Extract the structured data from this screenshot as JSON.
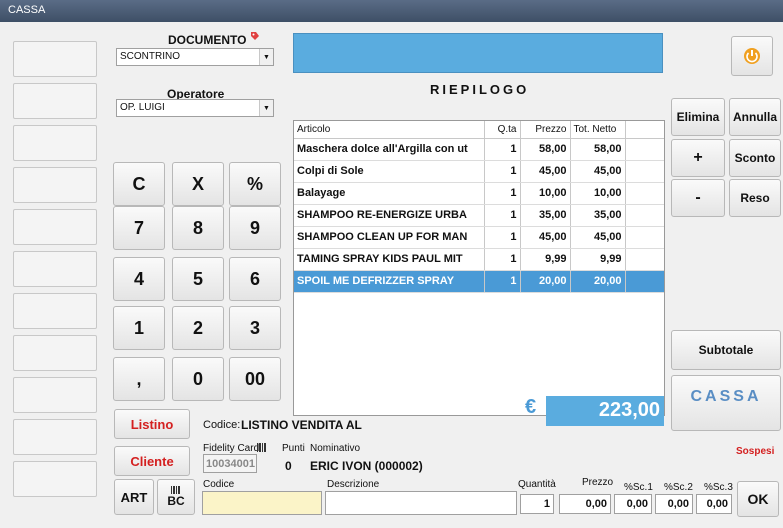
{
  "window": {
    "title": "CASSA"
  },
  "documento": {
    "label": "DOCUMENTO",
    "value": "SCONTRINO"
  },
  "operatore": {
    "label": "Operatore",
    "value": "OP. LUIGI"
  },
  "riepilogo": {
    "title": "RIEPILOGO",
    "columns": [
      "Articolo",
      "Q.ta",
      "Prezzo",
      "Tot. Netto"
    ],
    "rows": [
      [
        "Maschera dolce all'Argilla con ut",
        "1",
        "58,00",
        "58,00"
      ],
      [
        "Colpi di Sole",
        "1",
        "45,00",
        "45,00"
      ],
      [
        "Balayage",
        "1",
        "10,00",
        "10,00"
      ],
      [
        "SHAMPOO RE-ENERGIZE URBA",
        "1",
        "35,00",
        "35,00"
      ],
      [
        "SHAMPOO CLEAN UP FOR MAN",
        "1",
        "45,00",
        "45,00"
      ],
      [
        "TAMING SPRAY KIDS PAUL MIT",
        "1",
        "9,99",
        "9,99"
      ],
      [
        "SPOIL ME DEFRIZZER SPRAY",
        "1",
        "20,00",
        "20,00"
      ]
    ],
    "selected_row": 6
  },
  "keypad": {
    "c": "C",
    "x": "X",
    "pct": "%",
    "k7": "7",
    "k8": "8",
    "k9": "9",
    "k4": "4",
    "k5": "5",
    "k6": "6",
    "k1": "1",
    "k2": "2",
    "k3": "3",
    "comma": ",",
    "k0": "0",
    "k00": "00"
  },
  "actions": {
    "elimina": "Elimina",
    "annulla": "Annulla",
    "plus": "+",
    "sconto": "Sconto",
    "minus": "-",
    "reso": "Reso",
    "subtotale": "Subtotale",
    "cassa": "CASSA",
    "ok": "OK"
  },
  "total": {
    "currency": "€",
    "value": "223,00"
  },
  "listino": {
    "button": "Listino",
    "codice_label": "Codice:",
    "codice_value": "LISTINO VENDITA AL"
  },
  "cliente": {
    "button": "Cliente",
    "fidelity_label": "Fidelity Card",
    "fidelity_value": "10034001",
    "punti_label": "Punti",
    "punti_value": "0",
    "nominativo_label": "Nominativo",
    "nominativo_value": "ERIC IVON (000002)",
    "sospesi": "Sospesi"
  },
  "entry": {
    "art": "ART",
    "bc": "BC",
    "codice_label": "Codice",
    "codice_value": "",
    "descrizione_label": "Descrizione",
    "descrizione_value": "",
    "quantita_label": "Quantità",
    "quantita_value": "1",
    "prezzo_label": "Prezzo",
    "prezzo_value": "0,00",
    "sc1_label": "%Sc.1",
    "sc1_value": "0,00",
    "sc2_label": "%Sc.2",
    "sc2_value": "0,00",
    "sc3_label": "%Sc.3",
    "sc3_value": "0,00"
  },
  "colors": {
    "accent": "#4a9ad6",
    "red": "#d42020",
    "cassa_text": "#5a8ec4"
  }
}
